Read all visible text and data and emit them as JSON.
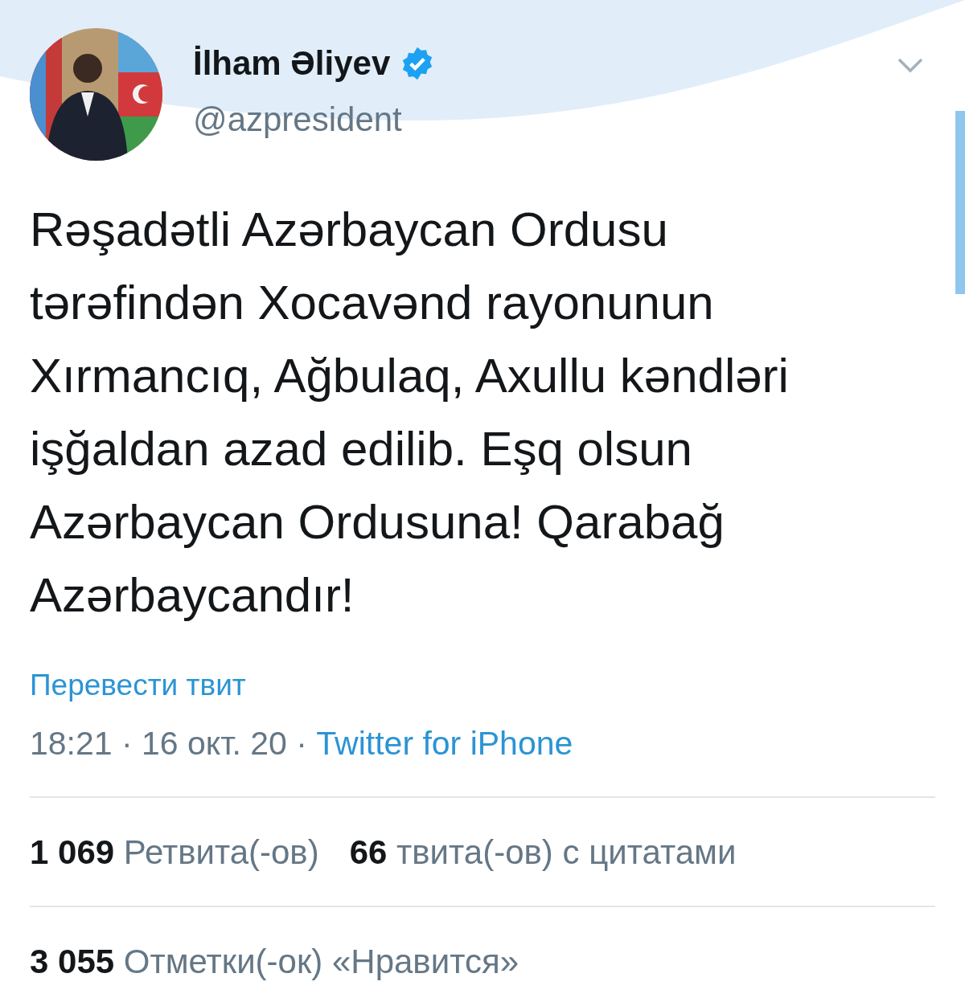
{
  "author": {
    "name": "İlham Əliyev",
    "verified": true,
    "handle": "@azpresident"
  },
  "tweet": {
    "text": "Rəşadətli Azərbaycan Ordusu\ntərəfindən Xocavənd rayonunun\nXırmancıq, Ağbulaq, Axullu kəndləri\nişğaldan azad edilib. Eşq olsun\nAzərbaycan Ordusuna! Qarabağ\nAzərbaycandır!",
    "translate": "Перевести твит",
    "meta": "18:21 · 16 окт. 20 · ",
    "source": "Twitter for iPhone"
  },
  "stats": [
    "**1 069** Ретвита(-ов)",
    "**66** твита(-ов) с цитатами"
  ],
  "likes": "**3 055** Отметки(-ок) «Нравится»"
}
